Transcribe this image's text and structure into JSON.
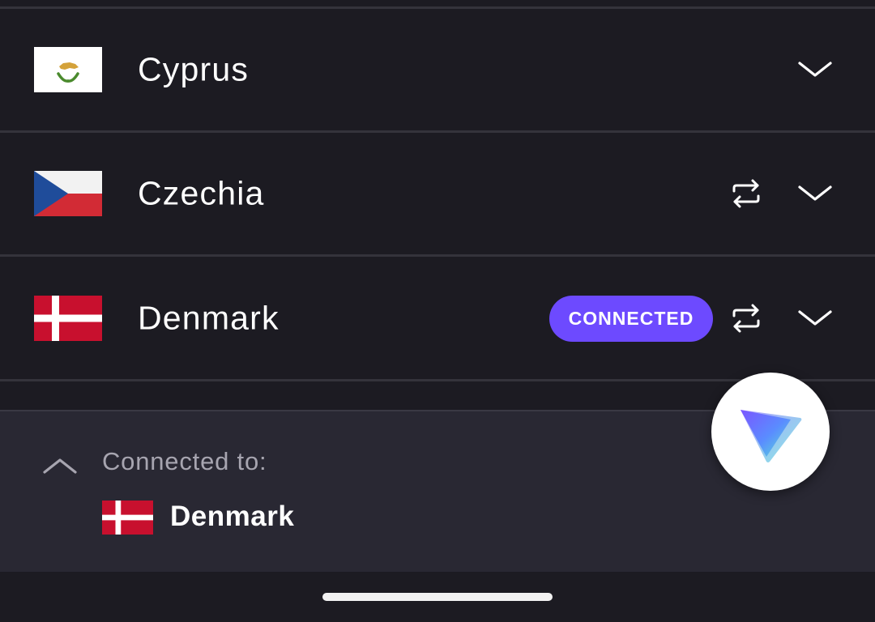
{
  "countries": [
    {
      "name": "Cyprus",
      "flag": "cyprus-flag-icon",
      "has_swap": false,
      "connected_badge": ""
    },
    {
      "name": "Czechia",
      "flag": "czechia-flag-icon",
      "has_swap": true,
      "connected_badge": ""
    },
    {
      "name": "Denmark",
      "flag": "denmark-flag-icon",
      "has_swap": true,
      "connected_badge": "CONNECTED"
    }
  ],
  "status_panel": {
    "label": "Connected to:",
    "country": "Denmark",
    "flag": "denmark-flag-icon"
  },
  "icons": {
    "expand": "chevron-down-icon",
    "collapse": "chevron-up-icon",
    "swap": "swap-arrows-icon",
    "fab": "proton-vpn-logo-icon"
  },
  "colors": {
    "background": "#1c1b22",
    "panel": "#292833",
    "divider": "#34333b",
    "accent": "#6d4aff",
    "text": "#ffffff",
    "muted_text": "#a7a5b0"
  }
}
